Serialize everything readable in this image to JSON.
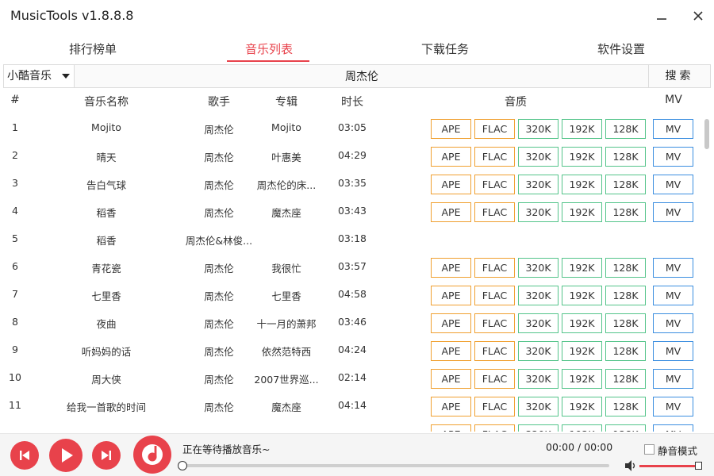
{
  "app": {
    "title": "MusicTools v1.8.8.8"
  },
  "tabs": [
    {
      "label": "排行榜单",
      "active": false
    },
    {
      "label": "音乐列表",
      "active": true
    },
    {
      "label": "下载任务",
      "active": false
    },
    {
      "label": "软件设置",
      "active": false
    }
  ],
  "search": {
    "source_selected": "小酷音乐",
    "query": "周杰伦",
    "button_label": "搜索"
  },
  "table": {
    "headers": {
      "index": "#",
      "name": "音乐名称",
      "singer": "歌手",
      "album": "专辑",
      "duration": "时长",
      "quality": "音质",
      "mv": "MV"
    },
    "quality_labels": [
      "APE",
      "FLAC",
      "320K",
      "192K",
      "128K"
    ],
    "mv_label": "MV",
    "rows": [
      {
        "index": "1",
        "name": "Mojito",
        "singer": "周杰伦",
        "album": "Mojito",
        "duration": "03:05",
        "has_quality": true
      },
      {
        "index": "2",
        "name": "晴天",
        "singer": "周杰伦",
        "album": "叶惠美",
        "duration": "04:29",
        "has_quality": true
      },
      {
        "index": "3",
        "name": "告白气球",
        "singer": "周杰伦",
        "album": "周杰伦的床...",
        "duration": "03:35",
        "has_quality": true
      },
      {
        "index": "4",
        "name": "稻香",
        "singer": "周杰伦",
        "album": "魔杰座",
        "duration": "03:43",
        "has_quality": true
      },
      {
        "index": "5",
        "name": "稻香",
        "singer": "周杰伦&林俊...",
        "album": "",
        "duration": "03:18",
        "has_quality": false
      },
      {
        "index": "6",
        "name": "青花瓷",
        "singer": "周杰伦",
        "album": "我很忙",
        "duration": "03:57",
        "has_quality": true
      },
      {
        "index": "7",
        "name": "七里香",
        "singer": "周杰伦",
        "album": "七里香",
        "duration": "04:58",
        "has_quality": true
      },
      {
        "index": "8",
        "name": "夜曲",
        "singer": "周杰伦",
        "album": "十一月的萧邦",
        "duration": "03:46",
        "has_quality": true
      },
      {
        "index": "9",
        "name": "听妈妈的话",
        "singer": "周杰伦",
        "album": "依然范特西",
        "duration": "04:24",
        "has_quality": true
      },
      {
        "index": "10",
        "name": "周大侠",
        "singer": "周杰伦",
        "album": "2007世界巡...",
        "duration": "02:14",
        "has_quality": true
      },
      {
        "index": "11",
        "name": "给我一首歌的时间",
        "singer": "周杰伦",
        "album": "魔杰座",
        "duration": "04:14",
        "has_quality": true
      },
      {
        "index": "",
        "name": "",
        "singer": "",
        "album": "",
        "duration": "",
        "has_quality": true
      }
    ]
  },
  "player": {
    "status_text": "正在等待播放音乐~",
    "time_text": "00:00 / 00:00",
    "mute_label": "静音模式",
    "muted": false,
    "progress": 0,
    "volume": 1.0
  },
  "colors": {
    "accent": "#e8424b",
    "lossless_border": "#f0a030",
    "bitrate_border": "#54c48a",
    "mv_border": "#3b8ee0"
  },
  "icons": {
    "minimize": "minimize-icon",
    "close": "close-icon",
    "caret": "caret-down-icon",
    "prev": "skip-previous-icon",
    "play": "play-icon",
    "next": "skip-next-icon",
    "disc": "music-disc-icon",
    "volume": "volume-icon"
  }
}
